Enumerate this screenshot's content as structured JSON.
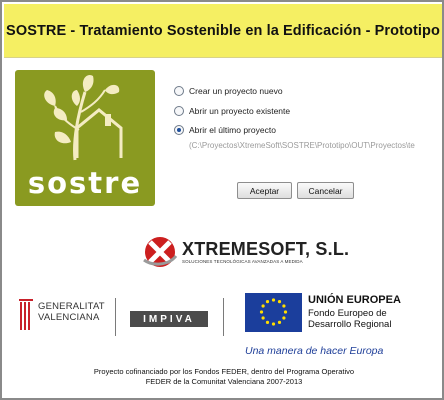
{
  "window": {
    "title": "SOSTRE - Tratamiento Sostenible en la Edificación - Prototipo"
  },
  "logo": {
    "word": "sostre",
    "icon": "leaf-house-icon",
    "color": "#8a9a21"
  },
  "options": {
    "items": [
      {
        "label": "Crear un proyecto nuevo",
        "selected": false
      },
      {
        "label": "Abrir un proyecto existente",
        "selected": false
      },
      {
        "label": "Abrir el último proyecto",
        "selected": true
      }
    ],
    "last_project_path": "(C:\\Proyectos\\XtremeSoft\\SOSTRE\\Prototipo\\OUT\\Proyectos\\te"
  },
  "buttons": {
    "accept": "Aceptar",
    "cancel": "Cancelar"
  },
  "sponsor": {
    "name": "XTREMESOFT, S.L.",
    "tagline": "SOLUCIONES TECNOLÓGICAS AVANZADAS A MEDIDA",
    "accent": "#cc1f1f"
  },
  "partners": {
    "gva_line1": "GENERALITAT",
    "gva_line2": "VALENCIANA",
    "impiva": "IMPIVA",
    "eu_title": "UNIÓN EUROPEA",
    "eu_fund_line1": "Fondo Europeo de",
    "eu_fund_line2": "Desarrollo Regional",
    "eu_slogan": "Una manera de hacer Europa"
  },
  "footer": {
    "line1": "Proyecto cofinanciado por los Fondos FEDER, dentro del Programa Operativo",
    "line2": "FEDER de la Comunitat Valenciana 2007-2013"
  },
  "colors": {
    "title_bar": "#f5ef63",
    "eu_blue": "#1b3e9c",
    "eu_star": "#ffdd00"
  }
}
